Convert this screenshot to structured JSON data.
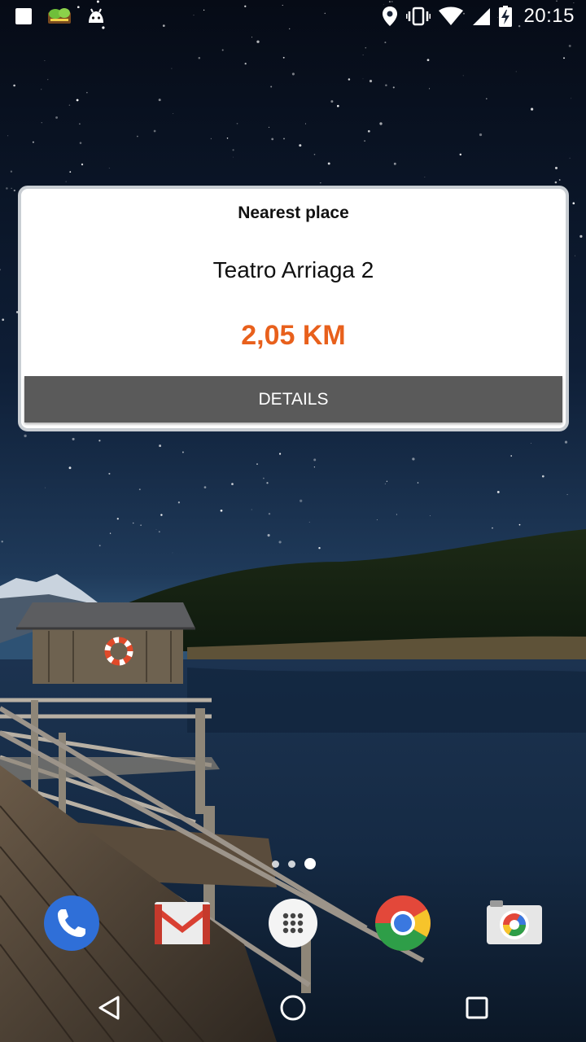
{
  "status_bar": {
    "left_icons": [
      "notification-square-icon",
      "app-notification-icon",
      "android-debug-icon"
    ],
    "right_icons": [
      "location-icon",
      "vibrate-icon",
      "wifi-icon",
      "cell-signal-icon",
      "battery-charging-icon"
    ],
    "time": "20:15"
  },
  "widget": {
    "header": "Nearest place",
    "place_name": "Teatro Arriaga 2",
    "distance": "2,05 KM",
    "button_label": "DETAILS",
    "accent_color": "#e8601c",
    "button_color": "#5a5a5a"
  },
  "page_indicator": {
    "pages": 3,
    "active_index": 2
  },
  "dock": {
    "apps": [
      {
        "name": "Phone",
        "icon": "phone-icon"
      },
      {
        "name": "Gmail",
        "icon": "gmail-icon"
      },
      {
        "name": "Apps",
        "icon": "app-drawer-icon"
      },
      {
        "name": "Chrome",
        "icon": "chrome-icon"
      },
      {
        "name": "Camera",
        "icon": "camera-icon"
      }
    ]
  },
  "nav_bar": {
    "buttons": [
      "back-icon",
      "home-icon",
      "recents-icon"
    ]
  }
}
